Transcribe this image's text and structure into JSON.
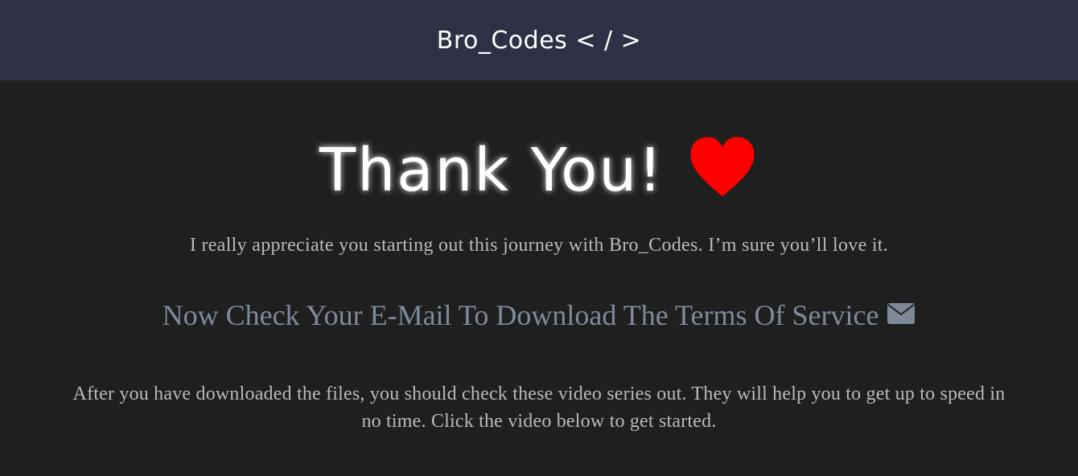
{
  "header": {
    "brand_name": "Bro_Codes < / >"
  },
  "hero": {
    "title": "Thank You!",
    "heart_icon": "heart-icon",
    "accent_color": "#ff0000"
  },
  "content": {
    "lead_text": "I really appreciate you starting out this journey with Bro_Codes. I’m sure you’ll love it.",
    "cta_text": "Now Check Your E-Mail To Download The Terms Of Service",
    "cta_icon": "envelope-icon",
    "body_text": "After you have downloaded the files, you should check these video series out. They will help you to get up to speed in no time. Click the video below to get started."
  },
  "colors": {
    "header_bg": "#2e3145",
    "page_bg": "#1f1f1f",
    "cta_text": "#7e8a9a"
  }
}
